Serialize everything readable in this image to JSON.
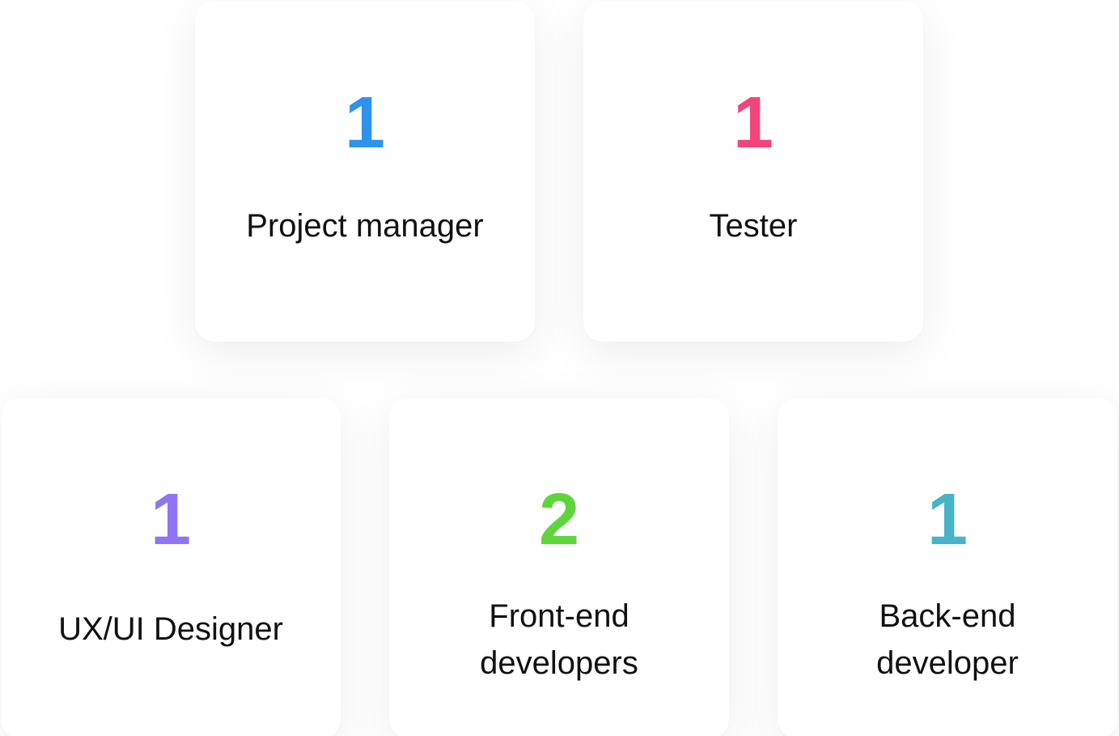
{
  "team": [
    {
      "id": "pm",
      "count": "1",
      "label": "Project manager",
      "color": "#2E93EE"
    },
    {
      "id": "tester",
      "count": "1",
      "label": "Tester",
      "color": "#F2457C"
    },
    {
      "id": "ux",
      "count": "1",
      "label": "UX/UI Designer",
      "color": "#9075F3"
    },
    {
      "id": "fe",
      "count": "2",
      "label_lines": [
        "Front-end",
        "developers"
      ],
      "color": "#5ED53A"
    },
    {
      "id": "be",
      "count": "1",
      "label_lines": [
        "Back-end",
        "developer"
      ],
      "color": "#49B3C9"
    }
  ]
}
